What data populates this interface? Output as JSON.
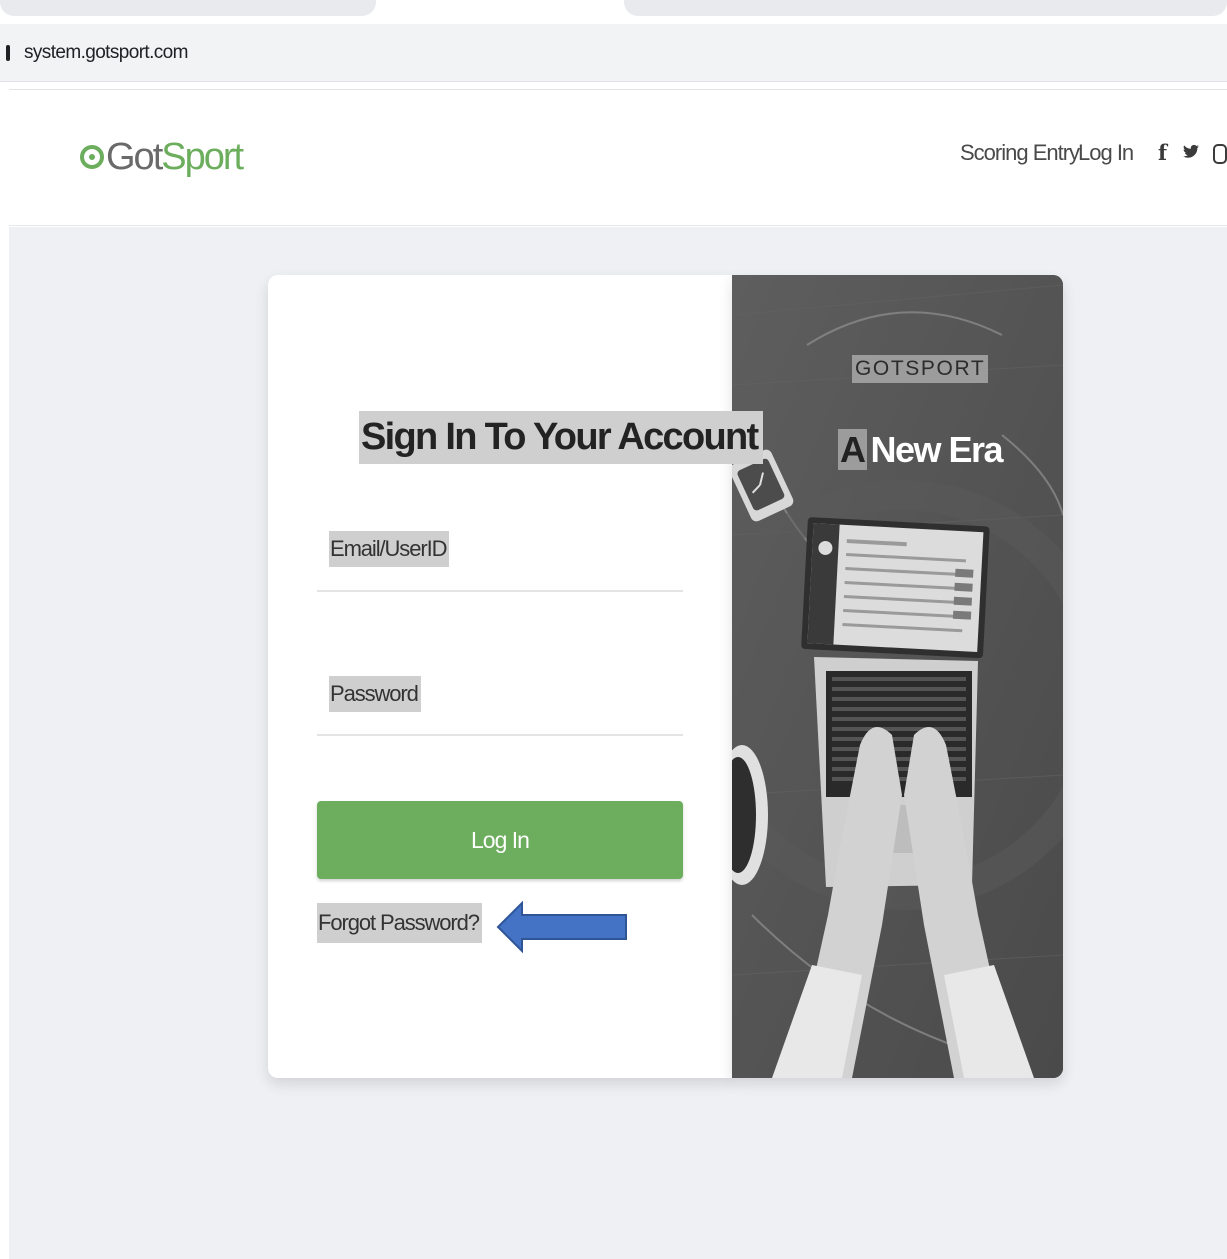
{
  "browser": {
    "url": "system.gotsport.com"
  },
  "header": {
    "logo_got": "Got",
    "logo_sport": "Sport",
    "nav": {
      "scoring_entry": "Scoring Entry",
      "log_in": "Log In"
    },
    "social": {
      "facebook": "f",
      "twitter": "🐦"
    }
  },
  "login": {
    "title": "Sign In To Your Account",
    "email_label": "Email/UserID",
    "password_label": "Password",
    "login_button": "Log In",
    "forgot_password": "Forgot Password?"
  },
  "promo": {
    "brand": "GOTSPORT",
    "tagline_a": "A",
    "tagline_rest": "New Era"
  },
  "colors": {
    "accent_green": "#6cae5d",
    "arrow_blue": "#4472c4"
  }
}
